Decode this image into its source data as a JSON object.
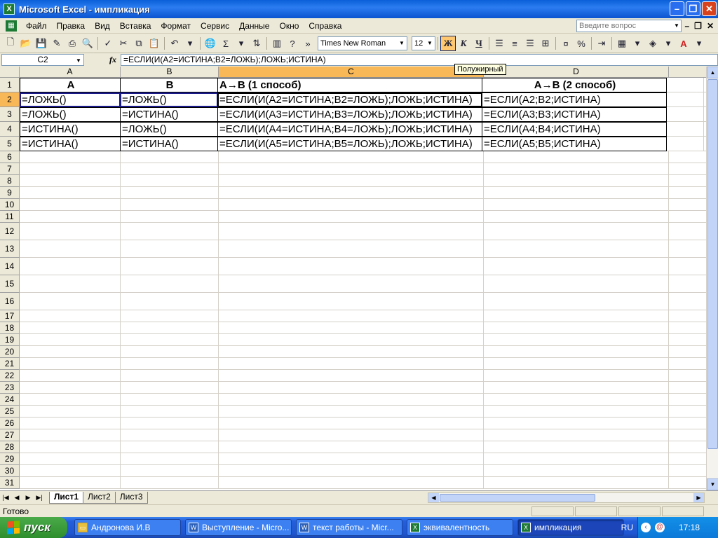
{
  "window": {
    "title": "Microsoft Excel - импликация"
  },
  "menu": {
    "items": [
      "Файл",
      "Правка",
      "Вид",
      "Вставка",
      "Формат",
      "Сервис",
      "Данные",
      "Окно",
      "Справка"
    ],
    "help_placeholder": "Введите вопрос"
  },
  "toolbar": {
    "font_name": "Times New Roman",
    "font_size": "12",
    "bold_label": "Ж",
    "italic_label": "К",
    "underline_label": "Ч",
    "percent_label": "%",
    "sum_label": "Σ",
    "tooltip": "Полужирный"
  },
  "formula_bar": {
    "name_box": "C2",
    "fx": "fx",
    "formula": "=ЕСЛИ(И(A2=ИСТИНА;B2=ЛОЖЬ);ЛОЖЬ;ИСТИНА)"
  },
  "grid": {
    "columns": [
      {
        "name": "A"
      },
      {
        "name": "B"
      },
      {
        "name": "C"
      },
      {
        "name": "D"
      },
      {
        "name": ""
      }
    ],
    "row_numbers": [
      "1",
      "2",
      "3",
      "4",
      "5",
      "6",
      "7",
      "8",
      "9",
      "10",
      "11",
      "12",
      "13",
      "14",
      "15",
      "16",
      "17",
      "18",
      "19",
      "20",
      "21",
      "22",
      "23",
      "24",
      "25",
      "26",
      "27",
      "28",
      "29",
      "30",
      "31"
    ],
    "rows": [
      [
        "A",
        "B",
        "A→B (1 способ)",
        "A→B (2 способ)"
      ],
      [
        "=ЛОЖЬ()",
        "=ЛОЖЬ()",
        "=ЕСЛИ(И(A2=ИСТИНА;B2=ЛОЖЬ);ЛОЖЬ;ИСТИНА)",
        "=ЕСЛИ(A2;B2;ИСТИНА)"
      ],
      [
        "=ЛОЖЬ()",
        "=ИСТИНА()",
        "=ЕСЛИ(И(A3=ИСТИНА;B3=ЛОЖЬ);ЛОЖЬ;ИСТИНА)",
        "=ЕСЛИ(A3;B3;ИСТИНА)"
      ],
      [
        "=ИСТИНА()",
        "=ЛОЖЬ()",
        "=ЕСЛИ(И(A4=ИСТИНА;B4=ЛОЖЬ);ЛОЖЬ;ИСТИНА)",
        "=ЕСЛИ(A4;B4;ИСТИНА)"
      ],
      [
        "=ИСТИНА()",
        "=ИСТИНА()",
        "=ЕСЛИ(И(A5=ИСТИНА;B5=ЛОЖЬ);ЛОЖЬ;ИСТИНА)",
        "=ЕСЛИ(A5;B5;ИСТИНА)"
      ]
    ],
    "active_cell": "C2"
  },
  "sheets": {
    "tabs": [
      "Лист1",
      "Лист2",
      "Лист3"
    ],
    "active": "Лист1"
  },
  "status": {
    "text": "Готово"
  },
  "taskbar": {
    "start_label": "пуск",
    "items": [
      "Андронова И.В",
      "Выступление - Micro...",
      "текст работы - Micr...",
      "эквивалентность",
      "импликация"
    ],
    "active": "импликация",
    "lang": "RU",
    "clock": "17:18"
  },
  "colors": {
    "accent": "#f8b858",
    "ref_a": "#2040c0",
    "ref_b": "#208020"
  }
}
